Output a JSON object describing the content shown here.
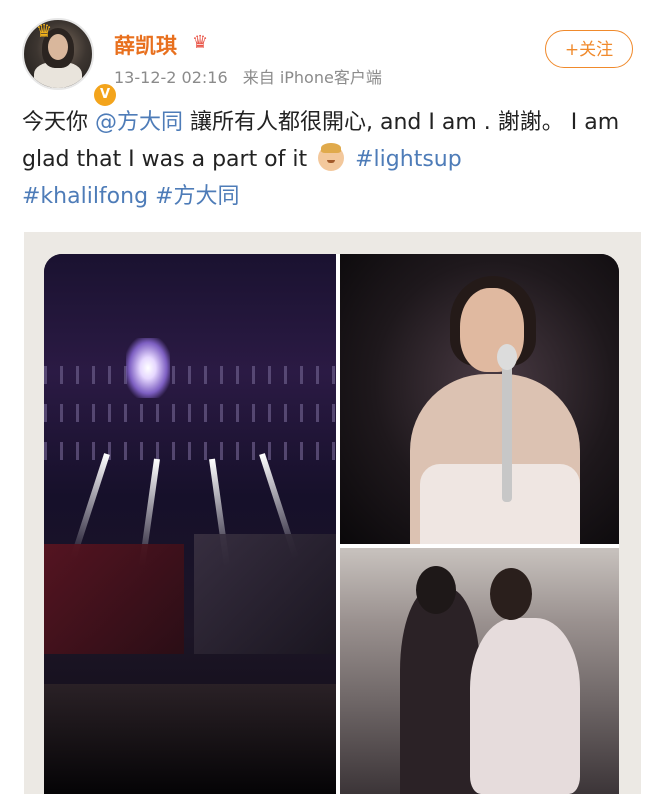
{
  "post": {
    "username": "薛凯琪",
    "timestamp": "13-12-2 02:16",
    "source": "来自 iPhone客户端",
    "follow_label": "+关注",
    "text": {
      "part1": "今天你 ",
      "mention": "@方大同",
      "part2": "  讓所有人都很開心, and I am . 謝謝。 I am glad that I was a part of it",
      "hashtag1": "#lightsup",
      "hashtag2": "#khalilfong",
      "hashtag3": "#方大同"
    }
  },
  "icons": {
    "crown": "crown-icon",
    "verified": "verified-icon",
    "member_badge": "member-badge-icon",
    "emoji": "face-emoji-icon"
  },
  "colors": {
    "username": "#e8701e",
    "link": "#4e7cb8",
    "follow": "#f08a2c",
    "meta": "#8b8b8b"
  }
}
